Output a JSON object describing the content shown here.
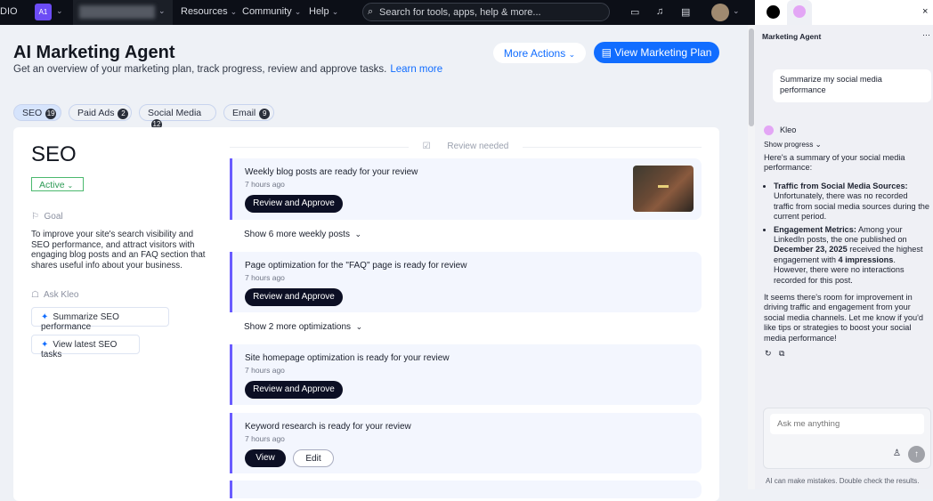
{
  "topbar": {
    "brand": "DIO",
    "workspace_badge": "A1",
    "nav": [
      "Resources",
      "Community",
      "Help"
    ],
    "search_placeholder": "Search for tools, apps, help & more..."
  },
  "header": {
    "title": "AI Marketing Agent",
    "subtitle": "Get an overview of your marketing plan, track progress, review and approve tasks.",
    "learn_more": "Learn more",
    "more_actions": "More Actions",
    "view_plan": "View Marketing Plan"
  },
  "tabs": [
    {
      "label": "SEO",
      "count": "19"
    },
    {
      "label": "Paid Ads",
      "count": "2"
    },
    {
      "label": "Social Media",
      "count": "12"
    },
    {
      "label": "Email",
      "count": "9"
    }
  ],
  "seo": {
    "title": "SEO",
    "status": "Active",
    "goal_label": "Goal",
    "goal_text": "To improve your site's search visibility and SEO performance, and attract visitors with engaging blog posts and an FAQ section that shares useful info about your business.",
    "ask_label": "Ask Kleo",
    "ask_buttons": [
      "Summarize SEO performance",
      "View latest SEO tasks"
    ]
  },
  "tasks": {
    "divider": "Review needed",
    "cards": [
      {
        "title": "Weekly blog posts are ready for your review",
        "time": "7 hours ago",
        "action": "Review and Approve"
      },
      {
        "title": "Page optimization for the \"FAQ\" page is ready for review",
        "time": "7 hours ago",
        "action": "Review and Approve"
      },
      {
        "title": "Site homepage optimization is ready for your review",
        "time": "7 hours ago",
        "action": "Review and Approve"
      },
      {
        "title": "Keyword research is ready for your review",
        "time": "7 hours ago",
        "action": "View",
        "action2": "Edit"
      }
    ],
    "show_more": [
      "Show 6 more weekly posts",
      "Show 2 more optimizations"
    ]
  },
  "chat": {
    "title": "Marketing Agent",
    "user_message": "Summarize my social media performance",
    "agent_name": "Kleo",
    "show_progress": "Show progress",
    "intro": "Here's a summary of your social media performance:",
    "b1_bold": "Traffic from Social Media Sources:",
    "b1_text": " Unfortunately, there was no recorded traffic from social media sources during the current period.",
    "b2_bold": "Engagement Metrics:",
    "b2_t1": " Among your LinkedIn posts, the one published on ",
    "b2_date": "December 23, 2025",
    "b2_t2": " received the highest engagement with ",
    "b2_imp": "4 impressions",
    "b2_t3": ". However, there were no interactions recorded for this post.",
    "outro": "It seems there's room for improvement in driving traffic and engagement from your social media channels. Let me know if you'd like tips or strategies to boost your social media performance!",
    "input_placeholder": "Ask me anything",
    "disclaimer": "AI can make mistakes. Double check the results."
  },
  "colors": {
    "accent": "#116dff",
    "dark_button": "#0c0f24",
    "active": "#2e9b56"
  }
}
